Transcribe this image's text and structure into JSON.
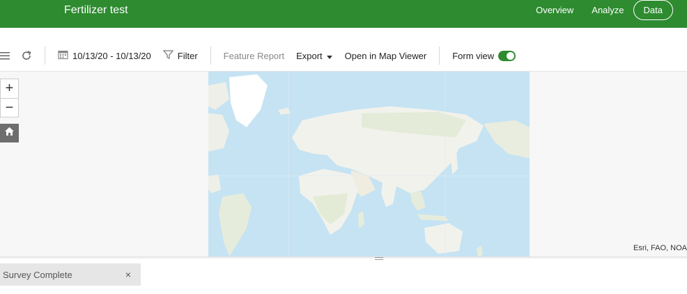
{
  "header": {
    "title": "Fertilizer test",
    "nav": [
      {
        "label": "Overview"
      },
      {
        "label": "Analyze"
      },
      {
        "label": "Data"
      }
    ]
  },
  "toolbar": {
    "date_range": "10/13/20 - 10/13/20",
    "filter_label": "Filter",
    "feature_report_label": "Feature Report",
    "export_label": "Export",
    "open_map_viewer_label": "Open in Map Viewer",
    "form_view_label": "Form view",
    "form_view_on": true
  },
  "map": {
    "attribution": "Esri, FAO, NOA",
    "zoom_in": "+",
    "zoom_out": "−"
  },
  "filter_chip": {
    "label": "Survey Complete",
    "close": "×"
  },
  "colors": {
    "header_bg": "#2e8b30",
    "toggle_on": "#2e8b30",
    "ocean": "#c5e3f3",
    "land": "#f2f2ec"
  }
}
